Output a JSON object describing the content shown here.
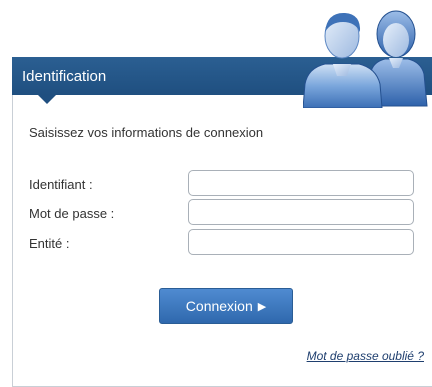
{
  "header": {
    "title": "Identification"
  },
  "form": {
    "intro": "Saisissez vos informations de connexion",
    "fields": [
      {
        "label": "Identifiant :",
        "value": "",
        "placeholder": ""
      },
      {
        "label": "Mot de passe :",
        "value": "",
        "placeholder": ""
      },
      {
        "label": "Entité :",
        "value": "",
        "placeholder": ""
      }
    ],
    "submit_label": "Connexion",
    "forgot_link": "Mot de passe oublié ?"
  },
  "colors": {
    "header": "#1f4f80",
    "button": "#3a76bf",
    "link": "#1f3f6f"
  },
  "icons": {
    "header_art": "users-icon",
    "submit_arrow": "play-arrow-icon"
  }
}
